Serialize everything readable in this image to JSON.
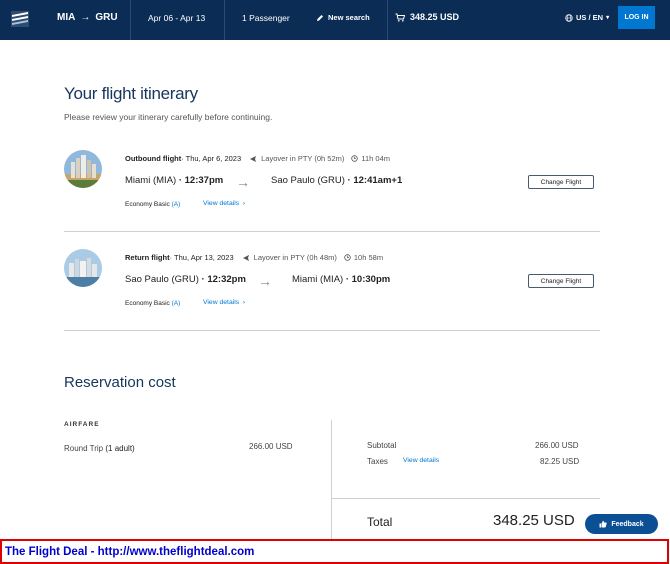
{
  "header": {
    "origin": "MIA",
    "destination": "GRU",
    "dates": "Apr 06 - Apr 13",
    "passengers": "1 Passenger",
    "new_search": "New search",
    "cart_total": "348.25 USD",
    "locale": "US / EN",
    "login": "LOG IN",
    "bar_color": "#0b2c55",
    "accent_color": "#0078d2"
  },
  "page": {
    "title": "Your flight itinerary",
    "subtitle": "Please review your itinerary carefully before continuing."
  },
  "flights": [
    {
      "label": "Outbound flight",
      "date": " · Thu, Apr 6, 2023",
      "layover": "Layover in PTY (0h 52m)",
      "duration": "11h 04m",
      "from_city": "Miami (MIA)",
      "from_time": " · 12:37pm",
      "to_city": "Sao Paulo (GRU)",
      "to_time": " · 12:41am+1",
      "cabin": "Economy Basic",
      "cabin_code": "(A)",
      "view_details": "View details",
      "change": "Change Flight"
    },
    {
      "label": "Return flight",
      "date": " · Thu, Apr 13, 2023",
      "layover": "Layover in PTY (0h 48m)",
      "duration": "10h 58m",
      "from_city": "Sao Paulo (GRU)",
      "from_time": " · 12:32pm",
      "to_city": "Miami (MIA)",
      "to_time": " · 10:30pm",
      "cabin": "Economy Basic",
      "cabin_code": "(A)",
      "view_details": "View details",
      "change": "Change Flight"
    }
  ],
  "cost": {
    "title": "Reservation cost",
    "airfare_label": "AIRFARE",
    "round_trip": "Round Trip",
    "adults": "(1 adult)",
    "airfare_amount": "266.00 USD",
    "subtotal_label": "Subtotal",
    "subtotal_amount": "266.00 USD",
    "taxes_label": "Taxes",
    "taxes_view": "View details",
    "taxes_amount": "82.25 USD",
    "total_label": "Total",
    "total_amount": "348.25 USD"
  },
  "feedback": "Feedback",
  "banner": "The Flight Deal - http://www.theflightdeal.com"
}
